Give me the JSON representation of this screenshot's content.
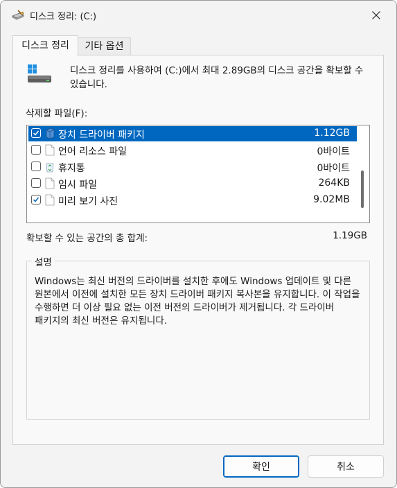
{
  "window": {
    "title": "디스크 정리: (C:)"
  },
  "tabs": [
    {
      "label": "디스크 정리",
      "active": true
    },
    {
      "label": "기타 옵션",
      "active": false
    }
  ],
  "intro": "디스크 정리를 사용하여 (C:)에서 최대 2.89GB의 디스크 공간을 확보할 수 있습니다.",
  "files_label": "삭제할 파일(F):",
  "files": [
    {
      "name": "장치 드라이버 패키지",
      "size": "1.12GB",
      "checked": true,
      "selected": true,
      "icon": "driver-package-icon"
    },
    {
      "name": "언어 리소스 파일",
      "size": "0바이트",
      "checked": false,
      "selected": false,
      "icon": "file-icon"
    },
    {
      "name": "휴지통",
      "size": "0바이트",
      "checked": false,
      "selected": false,
      "icon": "recycle-bin-icon"
    },
    {
      "name": "임시 파일",
      "size": "264KB",
      "checked": false,
      "selected": false,
      "icon": "file-icon"
    },
    {
      "name": "미리 보기 사진",
      "size": "9.02MB",
      "checked": true,
      "selected": false,
      "icon": "file-icon"
    }
  ],
  "total": {
    "label": "확보할 수 있는 공간의 총 합계:",
    "value": "1.19GB"
  },
  "description": {
    "legend": "설명",
    "text": "Windows는 최신 버전의 드라이버를 설치한 후에도 Windows 업데이트 및 다른 원본에서 이전에 설치한 모든 장치 드라이버 패키지 복사본을 유지합니다. 이 작업을 수행하면 더 이상 필요 없는 이전 버전의 드라이버가 제거됩니다. 각 드라이버 패키지의 최신 버전은 유지됩니다."
  },
  "buttons": {
    "ok": "확인",
    "cancel": "취소"
  },
  "colors": {
    "accent": "#0067c0",
    "panel": "#f9f9f9",
    "window": "#f3f3f3"
  }
}
